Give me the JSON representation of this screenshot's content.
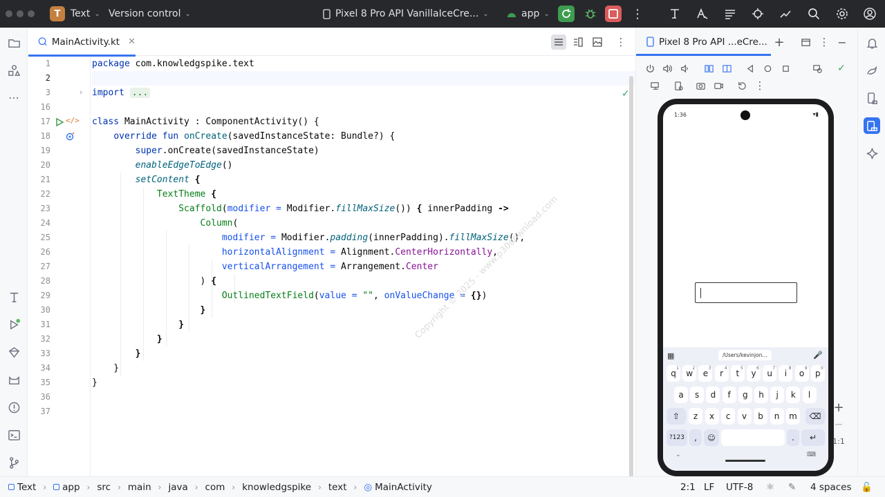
{
  "titlebar": {
    "project_letter": "T",
    "project_name": "Text",
    "vcs_label": "Version control",
    "device_label": "Pixel 8 Pro API VanillaIceCre...",
    "run_config": "app",
    "accent_run": "#3e9c4f",
    "accent_stop": "#db5c5c"
  },
  "editor": {
    "tab_label": "MainActivity.kt",
    "line_numbers": [
      "1",
      "2",
      "3",
      "16",
      "17",
      "18",
      "19",
      "20",
      "21",
      "22",
      "23",
      "24",
      "25",
      "26",
      "27",
      "28",
      "29",
      "30",
      "31",
      "32",
      "33",
      "34",
      "35",
      "36",
      "37"
    ]
  },
  "device_panel": {
    "tab_label": "Pixel 8 Pro API ...eCre...",
    "status_time": "1:36",
    "clipboard_chip": "/Users/kevinjon...",
    "zoom_label": "1:1",
    "keyboard": {
      "row1": [
        [
          "q",
          "1"
        ],
        [
          "w",
          "2"
        ],
        [
          "e",
          "3"
        ],
        [
          "r",
          "4"
        ],
        [
          "t",
          "5"
        ],
        [
          "y",
          "6"
        ],
        [
          "u",
          "7"
        ],
        [
          "i",
          "8"
        ],
        [
          "o",
          "9"
        ],
        [
          "p",
          "0"
        ]
      ],
      "row2": [
        "a",
        "s",
        "d",
        "f",
        "g",
        "h",
        "j",
        "k",
        "l"
      ],
      "row3": [
        "z",
        "x",
        "c",
        "v",
        "b",
        "n",
        "m"
      ],
      "sym_key": "?123",
      "comma_key": ",",
      "period_key": "."
    }
  },
  "statusbar": {
    "breadcrumbs": [
      "Text",
      "app",
      "src",
      "main",
      "java",
      "com",
      "knowledgspike",
      "text",
      "MainActivity"
    ],
    "position": "2:1",
    "line_sep": "LF",
    "encoding": "UTF-8",
    "indent": "4 spaces"
  },
  "watermark": "Copyright © 2025 - www.p30download.com"
}
